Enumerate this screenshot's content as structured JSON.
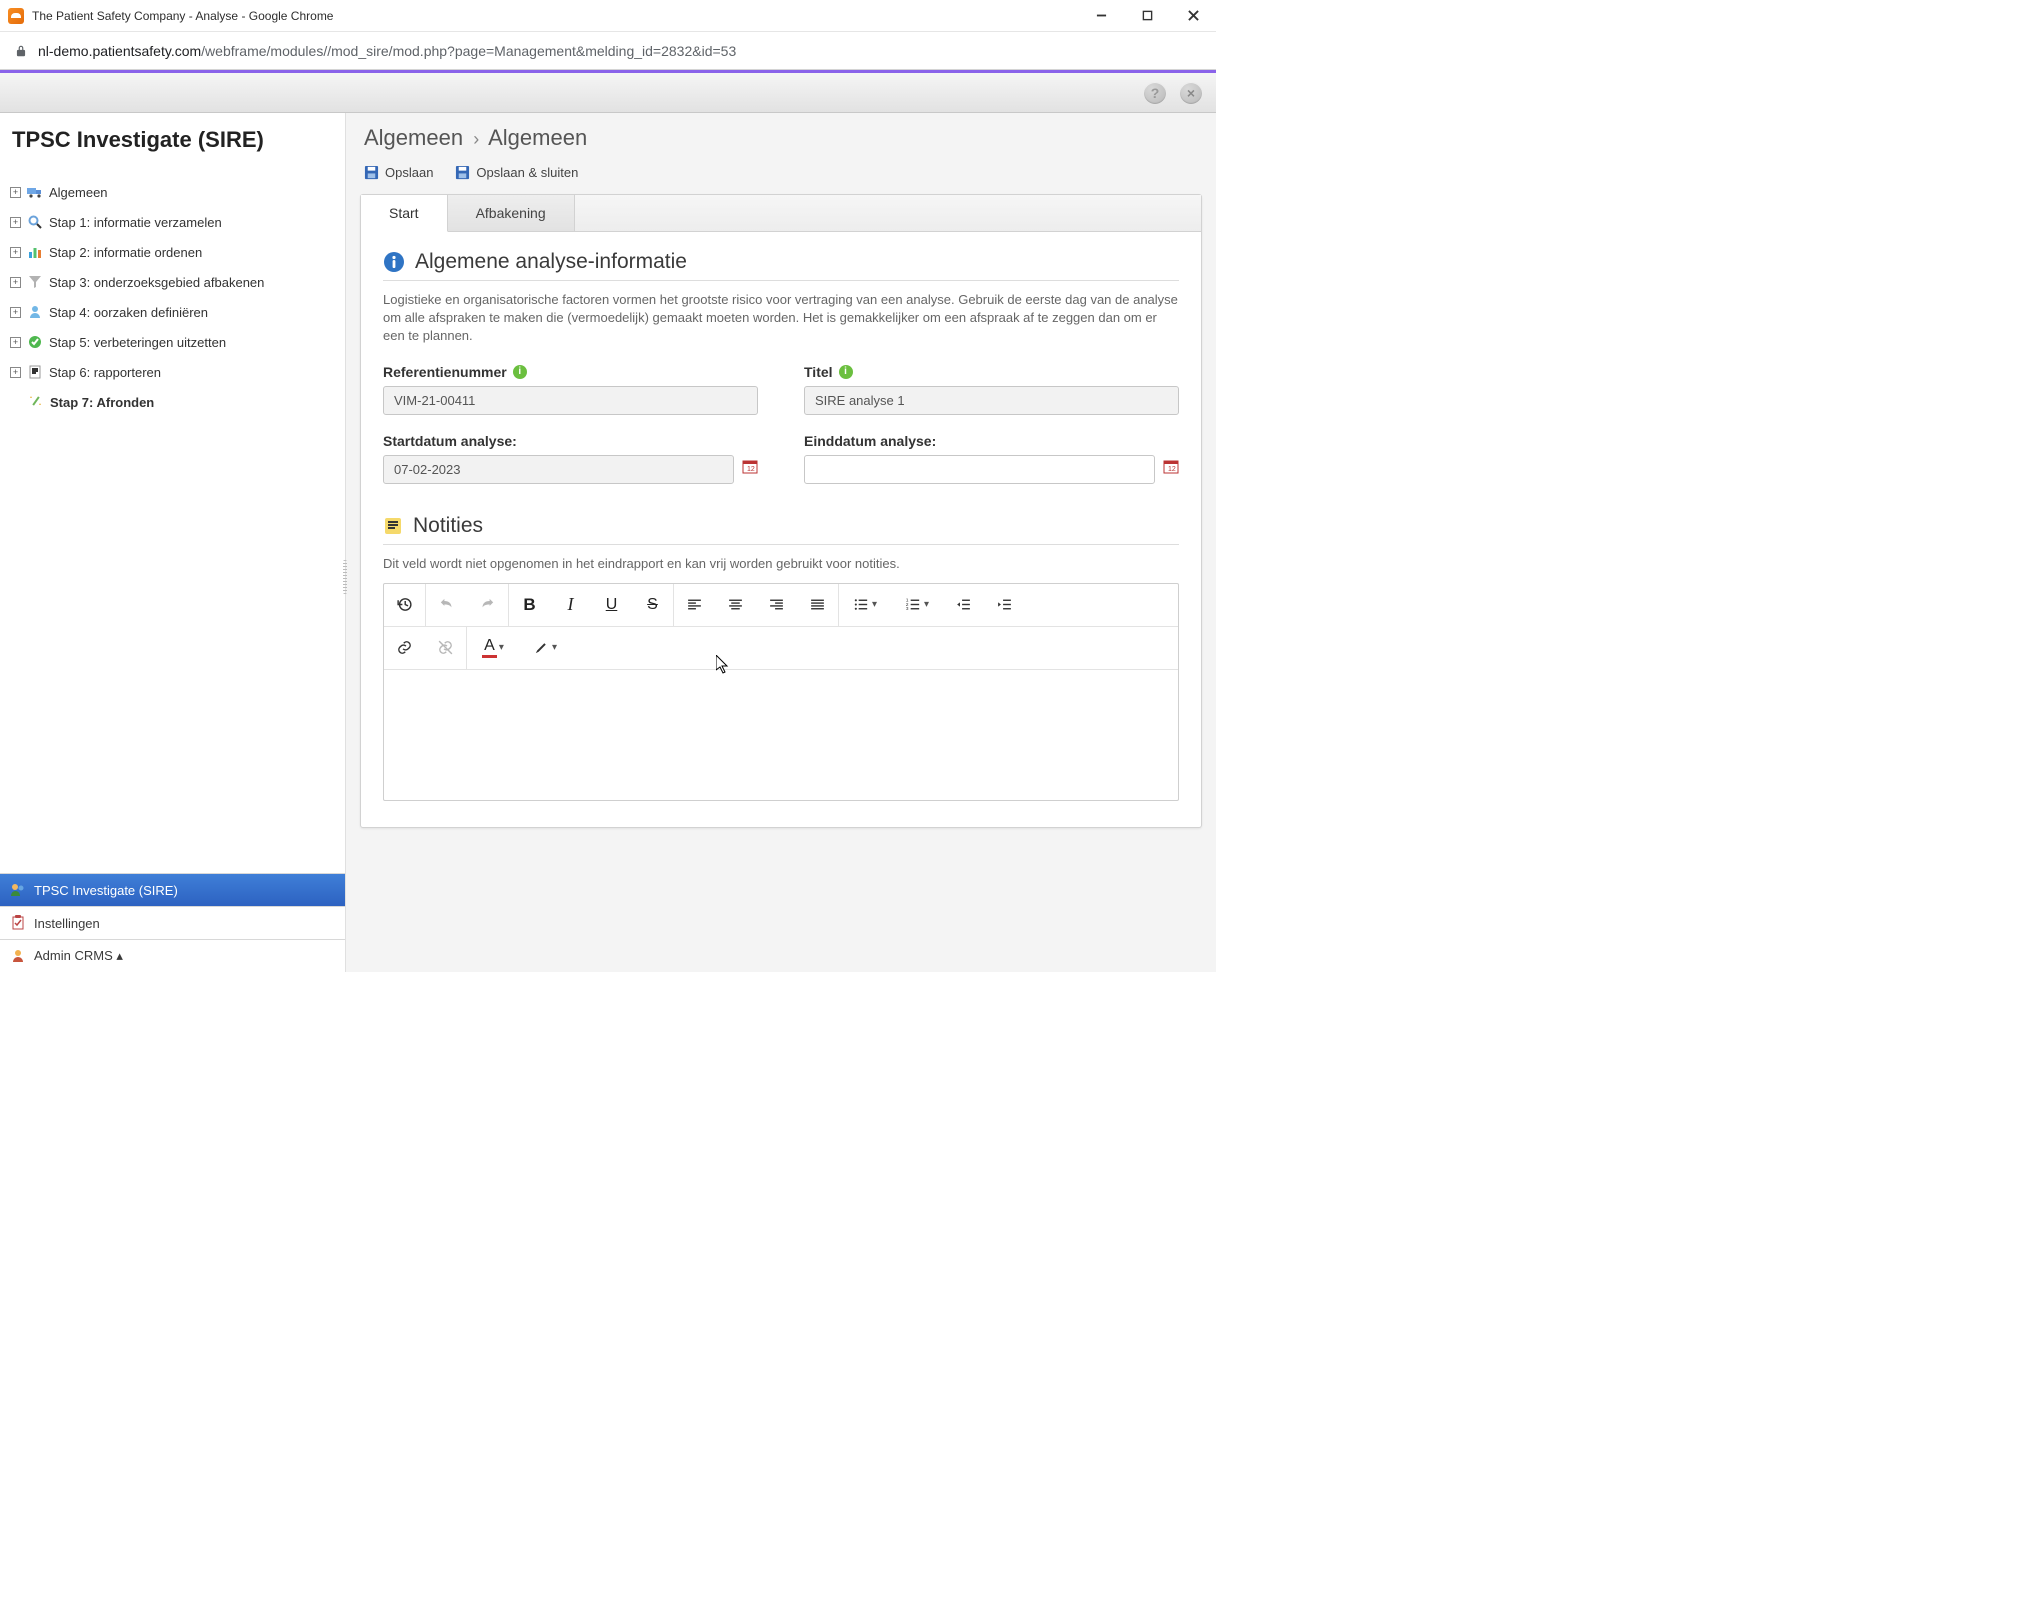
{
  "window": {
    "title": "The Patient Safety Company - Analyse - Google Chrome"
  },
  "address": {
    "host": "nl-demo.patientsafety.com",
    "path": "/webframe/modules//mod_sire/mod.php?page=Management&melding_id=2832&id=53"
  },
  "header": {
    "help_icon": "?",
    "close_icon": "×"
  },
  "sidebar": {
    "title": "TPSC Investigate (SIRE)",
    "items": [
      {
        "icon": "truck",
        "label": "Algemeen"
      },
      {
        "icon": "mag",
        "label": "Stap 1: informatie verzamelen"
      },
      {
        "icon": "bars",
        "label": "Stap 2: informatie ordenen"
      },
      {
        "icon": "funnel",
        "label": "Stap 3: onderzoeksgebied afbakenen"
      },
      {
        "icon": "user",
        "label": "Stap 4: oorzaken definiëren"
      },
      {
        "icon": "check",
        "label": "Stap 5: verbeteringen uitzetten"
      },
      {
        "icon": "report",
        "label": "Stap 6: rapporteren"
      },
      {
        "icon": "wand",
        "label": "Stap 7: Afronden",
        "active": true
      }
    ],
    "bottom": [
      {
        "icon": "userblue",
        "label": "TPSC Investigate (SIRE)",
        "selected": true
      },
      {
        "icon": "clip",
        "label": "Instellingen"
      },
      {
        "icon": "admin",
        "label": "Admin CRMS ▴"
      }
    ]
  },
  "breadcrumb": {
    "a": "Algemeen",
    "b": "Algemeen"
  },
  "toolbar": {
    "save_label": "Opslaan",
    "save_close_label": "Opslaan & sluiten"
  },
  "tabs": [
    {
      "label": "Start",
      "active": true
    },
    {
      "label": "Afbakening"
    }
  ],
  "section1": {
    "title": "Algemene analyse-informatie",
    "desc": "Logistieke en organisatorische factoren vormen het grootste risico voor vertraging van een analyse. Gebruik de eerste dag van de analyse om alle afspraken te maken die (vermoedelijk) gemaakt moeten worden. Het is gemakkelijker om een afspraak af te zeggen dan om er een te plannen.",
    "ref_label": "Referentienummer",
    "ref_value": "VIM-21-00411",
    "title_label": "Titel",
    "title_value": "SIRE analyse 1",
    "start_label": "Startdatum analyse:",
    "start_value": "07-02-2023",
    "end_label": "Einddatum analyse:",
    "end_value": ""
  },
  "section2": {
    "title": "Notities",
    "desc": "Dit veld wordt niet opgenomen in het eindrapport en kan vrij worden gebruikt voor notities."
  },
  "editor_buttons_row1": [
    "history",
    "undo",
    "redo",
    "sep",
    "bold",
    "italic",
    "underline",
    "strike",
    "sep",
    "align-left",
    "align-center",
    "align-right",
    "align-justify",
    "sep",
    "ul",
    "ol",
    "outdent",
    "indent"
  ]
}
